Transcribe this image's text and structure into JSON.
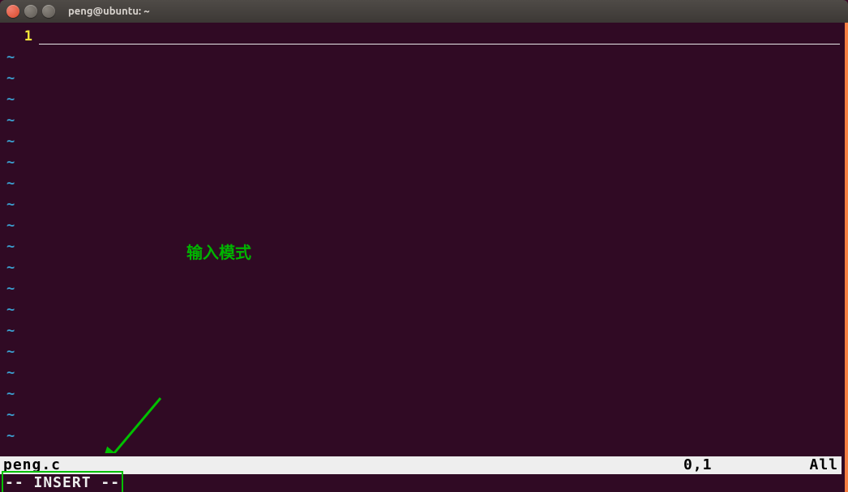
{
  "window": {
    "title": "peng@ubuntu: ~"
  },
  "editor": {
    "line_number": "1",
    "tilde": "~",
    "tilde_count": 19
  },
  "annotation": {
    "label": "输入模式"
  },
  "status": {
    "filename": "peng.c",
    "position": "0,1",
    "scroll": "All"
  },
  "mode": {
    "text": "-- INSERT --"
  }
}
